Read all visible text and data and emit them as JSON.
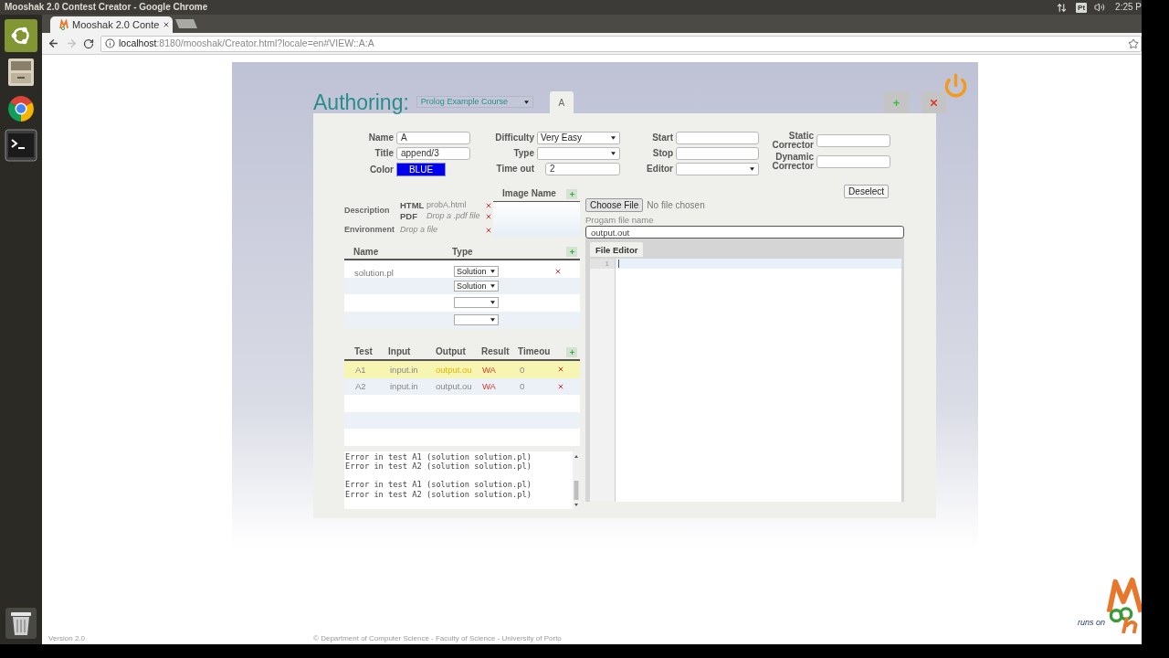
{
  "system_bar": {
    "window_title": "Mooshak 2.0 Contest Creator - Google Chrome",
    "keyboard_layout": "Pt",
    "clock": "2:25 P"
  },
  "browser": {
    "tabs": [
      {
        "title": "Mooshak 2.0 Conte",
        "selected": true
      }
    ],
    "url": {
      "host": "localhost",
      "path": ":8180/mooshak/Creator.html?locale=en#VIEW::A:A"
    }
  },
  "page": {
    "heading": "Authoring:",
    "course_select": "Prolog Example Course",
    "problem_tabs": [
      {
        "label": "A",
        "selected": true
      }
    ],
    "problem_form": {
      "columns": [
        [
          {
            "label": "Name",
            "kind": "text",
            "value": "A"
          },
          {
            "label": "Title",
            "kind": "text",
            "value": "append/3"
          },
          {
            "label": "Color",
            "kind": "color",
            "value": "BLUE"
          }
        ],
        [
          {
            "label": "Difficulty",
            "kind": "select",
            "value": "Very Easy"
          },
          {
            "label": "Type",
            "kind": "select"
          },
          {
            "label": "Time out",
            "kind": "text",
            "value": "2"
          }
        ],
        [
          {
            "label": "Start",
            "kind": "text"
          },
          {
            "label": "Stop",
            "kind": "text"
          },
          {
            "label": "Editor",
            "kind": "select"
          }
        ],
        [
          {
            "label": "Static Corrector",
            "kind": "text"
          },
          {
            "label": "Dynamic Corrector",
            "kind": "text"
          }
        ]
      ]
    },
    "resources": [
      {
        "label": "Description",
        "files": [
          {
            "format": "HTML",
            "value": "probA.html"
          },
          {
            "format": "PDF",
            "placeholder": "Drop a .pdf file"
          }
        ]
      },
      {
        "label": "Environment",
        "files": [
          {
            "placeholder": "Drop a file"
          }
        ]
      }
    ],
    "images": {
      "columns": [
        "Image Name"
      ]
    },
    "program_files": {
      "columns": [
        "Name",
        "Type"
      ],
      "rows": [
        {
          "kind": "file",
          "name": "solution.pl",
          "type": "Solution"
        },
        {
          "kind": "slot",
          "type": "Solution"
        },
        {
          "kind": "slot"
        },
        {
          "kind": "slot"
        }
      ]
    },
    "tests": {
      "columns": [
        "Test",
        "Input",
        "Output",
        "Result",
        "Timeou"
      ],
      "rows": [
        {
          "test": "A1",
          "input": "input.in",
          "output": "output.ou",
          "result": "WA",
          "timeout": "0",
          "selected": true
        },
        {
          "test": "A2",
          "input": "input.in",
          "output": "output.ou",
          "result": "WA",
          "timeout": "0",
          "selected": false
        }
      ]
    },
    "console": "Error in test A1 (solution solution.pl)\nError in test A2 (solution solution.pl)\n\nError in test A1 (solution solution.pl)\nError in test A2 (solution solution.pl)",
    "deselect_button": "Deselect",
    "file_upload": {
      "button": "Choose File",
      "status": "No file chosen"
    },
    "program_file_name": {
      "label": "Progam file name",
      "value": "output.out"
    },
    "editor": {
      "tabs": [
        {
          "label": "File Editor",
          "selected": true
        }
      ],
      "line_numbers": [
        "1"
      ]
    },
    "footer": {
      "version": "Version 2.0",
      "copyright": "© Department of Computer Science - Faculty of Science - University of Porto",
      "badge": "runs on"
    }
  }
}
